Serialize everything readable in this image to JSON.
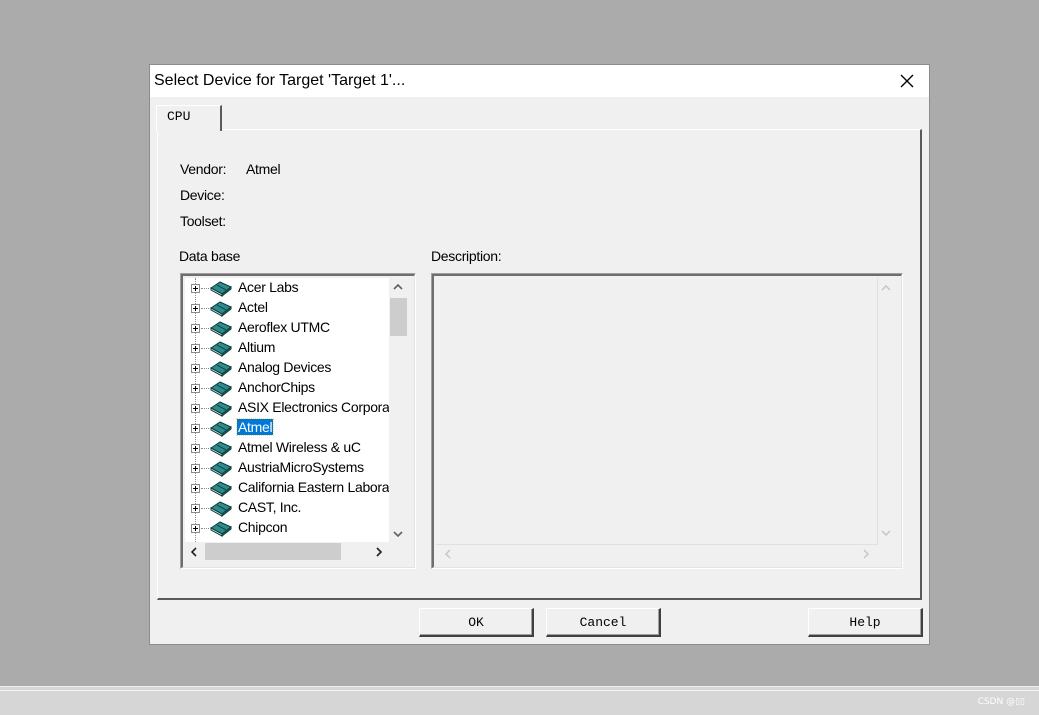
{
  "dialog": {
    "title": "Select Device for Target 'Target 1'...",
    "close_icon": "close-icon"
  },
  "tabs": [
    {
      "label": "CPU",
      "active": true
    }
  ],
  "info": {
    "vendor_label": "Vendor:",
    "vendor_value": "Atmel",
    "device_label": "Device:",
    "device_value": "",
    "toolset_label": "Toolset:",
    "toolset_value": ""
  },
  "database": {
    "label": "Data base",
    "item_icon": "book-icon",
    "expander_icon": "plus-box-icon",
    "items": [
      {
        "label": "Acer Labs"
      },
      {
        "label": "Actel"
      },
      {
        "label": "Aeroflex UTMC"
      },
      {
        "label": "Altium"
      },
      {
        "label": "Analog Devices"
      },
      {
        "label": "AnchorChips"
      },
      {
        "label": "ASIX Electronics Corporat"
      },
      {
        "label": "Atmel",
        "selected": true
      },
      {
        "label": "Atmel Wireless & uC"
      },
      {
        "label": "AustriaMicroSystems"
      },
      {
        "label": "California Eastern Laborat"
      },
      {
        "label": "CAST, Inc."
      },
      {
        "label": "Chipcon"
      }
    ]
  },
  "description": {
    "label": "Description:",
    "text": ""
  },
  "buttons": {
    "ok": "OK",
    "cancel": "Cancel",
    "help": "Help"
  },
  "watermark": "CSDN @▯▯",
  "colors": {
    "selection": "#0078d7",
    "dialog_bg": "#f0f0f0",
    "desktop_bg": "#ababab",
    "book_icon": "#1f6b6b"
  }
}
